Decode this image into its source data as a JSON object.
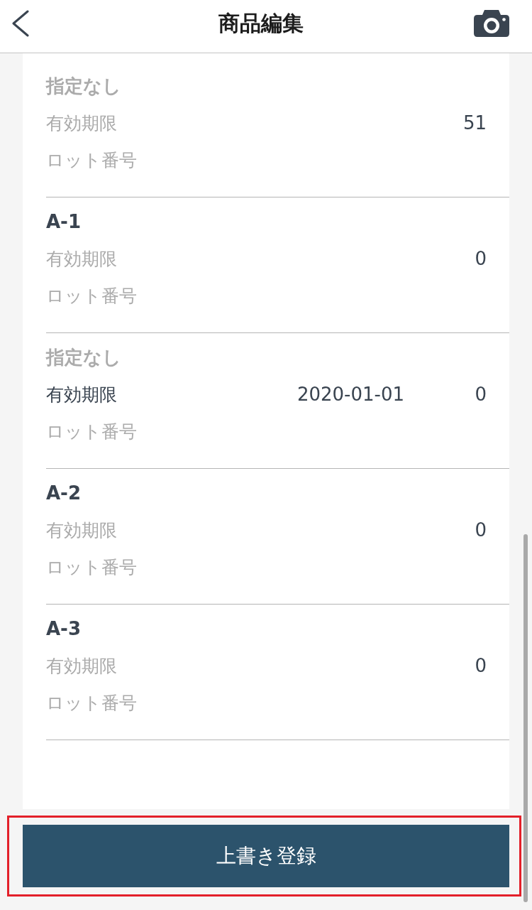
{
  "header": {
    "title": "商品編集"
  },
  "rows": [
    {
      "location": {
        "text": "指定なし",
        "set": false
      },
      "fields": [
        {
          "label": "有効期限",
          "set": false
        },
        {
          "label": "ロット番号",
          "set": false
        }
      ],
      "quantity": "51"
    },
    {
      "location": {
        "text": "A-1",
        "set": true
      },
      "fields": [
        {
          "label": "有効期限",
          "set": false
        },
        {
          "label": "ロット番号",
          "set": false
        }
      ],
      "quantity": "0"
    },
    {
      "location": {
        "text": "指定なし",
        "set": false
      },
      "fields": [
        {
          "label": "有効期限",
          "set": true,
          "value": "2020-01-01"
        },
        {
          "label": "ロット番号",
          "set": false
        }
      ],
      "quantity": "0"
    },
    {
      "location": {
        "text": "A-2",
        "set": true
      },
      "fields": [
        {
          "label": "有効期限",
          "set": false
        },
        {
          "label": "ロット番号",
          "set": false
        }
      ],
      "quantity": "0"
    },
    {
      "location": {
        "text": "A-3",
        "set": true
      },
      "fields": [
        {
          "label": "有効期限",
          "set": false
        },
        {
          "label": "ロット番号",
          "set": false
        }
      ],
      "quantity": "0"
    }
  ],
  "submit_button": {
    "label": "上書き登録",
    "highlighted": true
  }
}
